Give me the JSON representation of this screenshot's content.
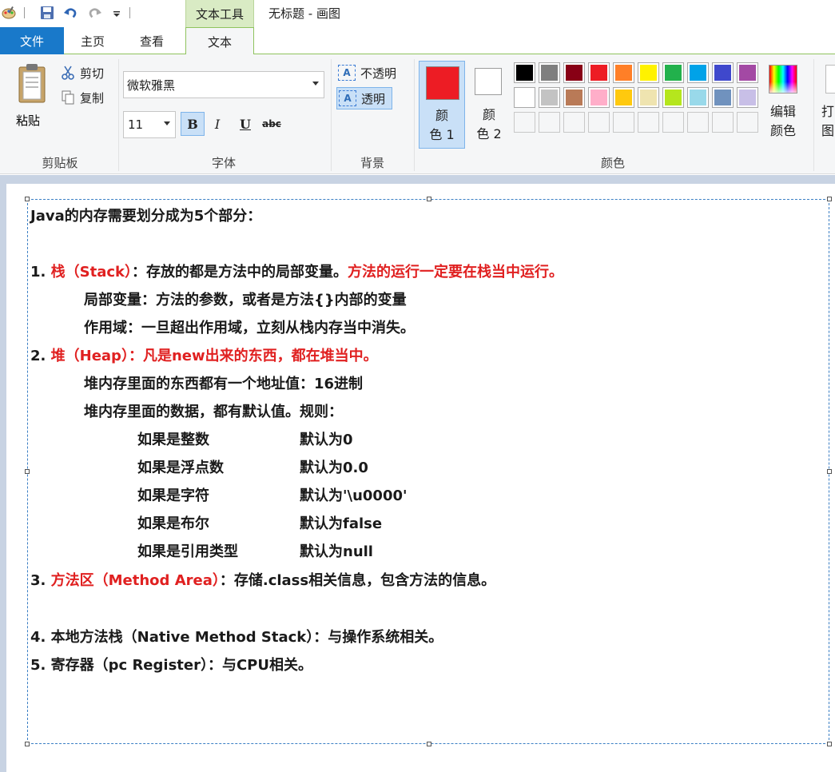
{
  "title_bar": {
    "context_tab": "文本工具",
    "window_title": "无标题 - 画图"
  },
  "tabs": [
    {
      "label": "文件"
    },
    {
      "label": "主页"
    },
    {
      "label": "查看"
    },
    {
      "label": "文本"
    }
  ],
  "ribbon": {
    "clipboard": {
      "paste": "粘贴",
      "cut": "剪切",
      "copy": "复制",
      "group": "剪贴板"
    },
    "font": {
      "family": "微软雅黑",
      "size": "11",
      "bold": "B",
      "italic": "I",
      "underline": "U",
      "strike": "abc",
      "group": "字体"
    },
    "background": {
      "opaque": "不透明",
      "transparent": "透明",
      "icon_letter": "A",
      "group": "背景"
    },
    "colors": {
      "color1_line1": "颜",
      "color1_line2": "色 1",
      "color2_line1": "颜",
      "color2_line2": "色 2",
      "color1_value": "#ed1c24",
      "color2_value": "#ffffff",
      "edit_line1": "编辑",
      "edit_line2": "颜色",
      "group": "颜色",
      "cutoff_line1": "打",
      "cutoff_line2": "图",
      "palette": [
        [
          "#000000",
          "#7f7f7f",
          "#880015",
          "#ed1c24",
          "#ff7f27",
          "#fff200",
          "#22b14c",
          "#00a2e8",
          "#3f48cc",
          "#a349a4"
        ],
        [
          "#ffffff",
          "#c3c3c3",
          "#b97a57",
          "#ffaec9",
          "#ffc90e",
          "#efe4b0",
          "#b5e61d",
          "#99d9ea",
          "#7092be",
          "#c8bfe7"
        ]
      ]
    }
  },
  "canvas_text": {
    "heading": "Java的内存需要划分成为5个部分：",
    "l1_num": "1. ",
    "l1_red": "栈（Stack）",
    "l1_black": "：存放的都是方法中的局部变量。",
    "l1_red2": "方法的运行一定要在栈当中运行。",
    "l1_sub1": "局部变量：方法的参数，或者是方法{}内部的变量",
    "l1_sub2": "作用域：一旦超出作用域，立刻从栈内存当中消失。",
    "l2_num": "2. ",
    "l2_red": "堆（Heap）：凡是new出来的东西，都在堆当中。",
    "l2_sub1": "堆内存里面的东西都有一个地址值：16进制",
    "l2_sub2": "堆内存里面的数据，都有默认值。规则：",
    "defaults": [
      {
        "type": "如果是整数",
        "value": "默认为0"
      },
      {
        "type": "如果是浮点数",
        "value": "默认为0.0"
      },
      {
        "type": "如果是字符",
        "value": "默认为'\\u0000'"
      },
      {
        "type": "如果是布尔",
        "value": "默认为false"
      },
      {
        "type": "如果是引用类型",
        "value": "默认为null"
      }
    ],
    "l3_num": "3. ",
    "l3_red": "方法区（Method Area）",
    "l3_black": "：存储.class相关信息，包含方法的信息。",
    "l4": "4. 本地方法栈（Native Method Stack）：与操作系统相关。",
    "l5": "5. 寄存器（pc Register）：与CPU相关。"
  }
}
